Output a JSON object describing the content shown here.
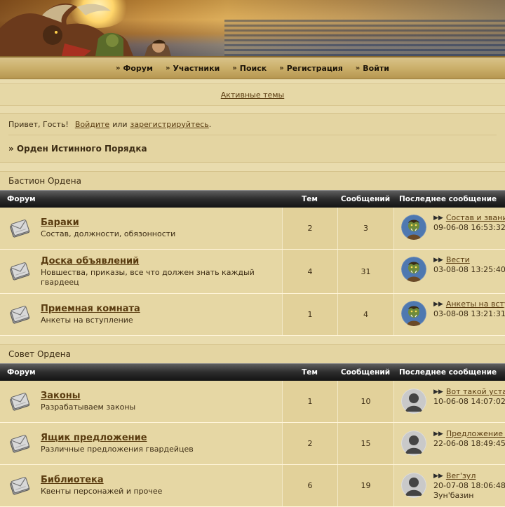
{
  "nav": {
    "items": [
      {
        "label": "Форум"
      },
      {
        "label": "Участники"
      },
      {
        "label": "Поиск"
      },
      {
        "label": "Регистрация"
      },
      {
        "label": "Войти"
      }
    ]
  },
  "active_topics": "Активные темы",
  "greeting": {
    "prefix": "Привет, Гость!",
    "login": "Войдите",
    "or": "или",
    "register": "зарегистрируйтесь",
    "dot": "."
  },
  "breadcrumb": "» Орден Истинного Порядка",
  "columns": {
    "forum": "Форум",
    "topics": "Тем",
    "posts": "Сообщений",
    "last": "Последнее сообщение"
  },
  "categories": [
    {
      "title": "Бастион Ордена",
      "forums": [
        {
          "name": "Бараки",
          "desc": "Состав, должности, обязонности",
          "topics": "2",
          "posts": "3",
          "last_title": "Состав и звания",
          "last_date": "09-06-08 16:53:32",
          "last_user": "",
          "avatar": "orc-avatar"
        },
        {
          "name": "Доска объявлений",
          "desc": "Новшества, приказы, все что должен знать каждый гвардеец",
          "topics": "4",
          "posts": "31",
          "last_title": "Вести",
          "last_date": "03-08-08 13:25:40",
          "last_user": "",
          "avatar": "orc-avatar"
        },
        {
          "name": "Приемная комната",
          "desc": "Анкеты на вступление",
          "topics": "1",
          "posts": "4",
          "last_title": "Анкеты на вступление",
          "last_date": "03-08-08 13:21:31",
          "last_user": "",
          "avatar": "orc-avatar"
        }
      ]
    },
    {
      "title": "Совет Ордена",
      "forums": [
        {
          "name": "Законы",
          "desc": "Разрабатываем законы",
          "topics": "1",
          "posts": "10",
          "last_title": "Вот такой устав",
          "last_date": "10-06-08 14:07:02",
          "last_user": "",
          "avatar": "default-avatar"
        },
        {
          "name": "Ящик предложение",
          "desc": "Различные предложения гвардейцев",
          "topics": "2",
          "posts": "15",
          "last_title": "Предложение по",
          "last_date": "22-06-08 18:49:45",
          "last_user": "",
          "avatar": "default-avatar"
        },
        {
          "name": "Библиотека",
          "desc": "Квенты персонажей и прочее",
          "topics": "6",
          "posts": "19",
          "last_title": "Вег'зул",
          "last_date": "20-07-08 18:06:48",
          "last_user": "Зун'базин",
          "avatar": "default-avatar"
        }
      ]
    }
  ]
}
